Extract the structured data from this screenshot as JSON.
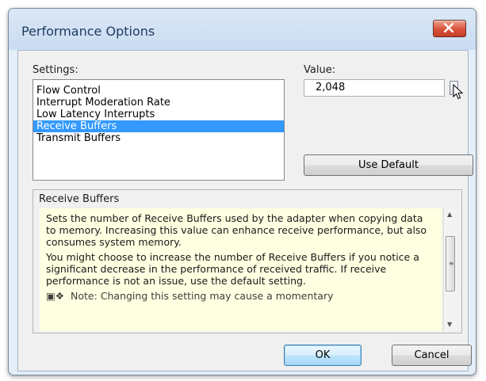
{
  "window": {
    "title": "Performance Options"
  },
  "settings": {
    "label": "Settings:",
    "items": [
      {
        "label": "Flow Control",
        "selected": false
      },
      {
        "label": "Interrupt Moderation Rate",
        "selected": false
      },
      {
        "label": "Low Latency Interrupts",
        "selected": false
      },
      {
        "label": "Receive Buffers",
        "selected": true
      },
      {
        "label": "Transmit Buffers",
        "selected": false
      }
    ]
  },
  "value": {
    "label": "Value:",
    "current": "2,048"
  },
  "use_default_label": "Use Default",
  "description": {
    "title": "Receive Buffers",
    "paragraph1": "Sets the number of Receive Buffers used by the adapter when copying data to memory. Increasing this value can enhance receive performance, but also consumes system memory.",
    "paragraph2": "You might choose to increase the number of Receive Buffers if you notice a significant decrease in the performance of received traffic. If receive performance is not an issue, use the default setting.",
    "paragraph3_partial": "Note: Changing this setting may cause a momentary"
  },
  "buttons": {
    "ok": "OK",
    "cancel": "Cancel"
  },
  "icons": {
    "close": "close-x-icon",
    "spinner": "spinner-icon",
    "cursor": "mouse-pointer-icon",
    "note": "note-icon",
    "scroll_up": "scroll-up-icon",
    "scroll_down": "scroll-down-icon"
  },
  "colors": {
    "selection": "#3399ff",
    "description_background": "#ffffe1",
    "close_button": "#d9533a"
  }
}
